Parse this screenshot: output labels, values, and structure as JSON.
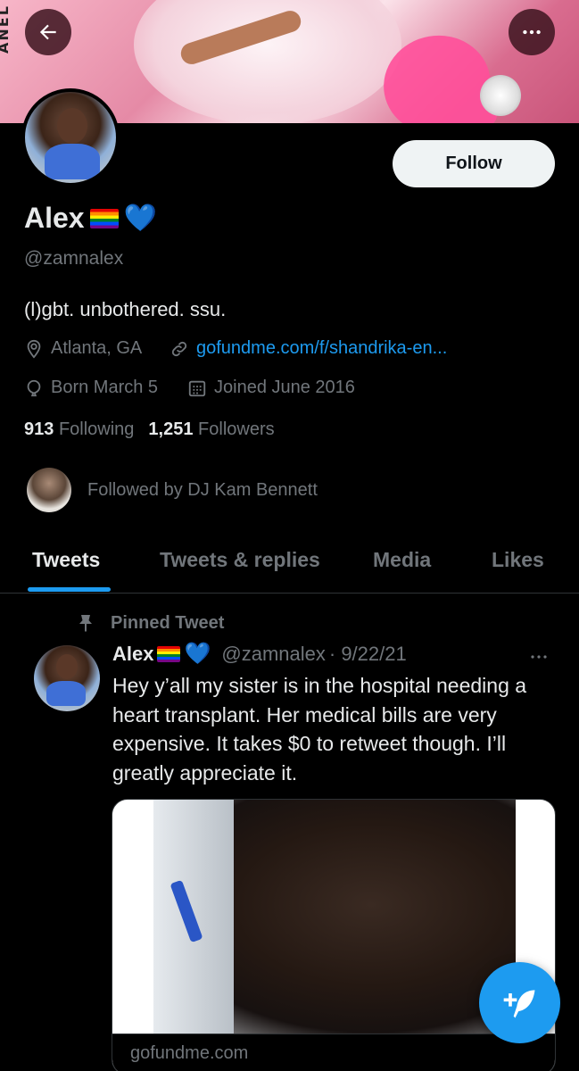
{
  "header": {
    "banner_brand_text": "ANEL",
    "back_icon": "arrow-left-icon",
    "more_icon": "more-horizontal-icon"
  },
  "profile": {
    "name": "Alex",
    "name_emojis": [
      "rainbow-flag",
      "blue-heart"
    ],
    "handle": "@zamnalex",
    "bio": "(l)gbt. unbothered. ssu.",
    "location": "Atlanta, GA",
    "link": "gofundme.com/f/shandrika-en...",
    "birthday": "Born March 5",
    "joined": "Joined June 2016",
    "following_count": "913",
    "following_label": "Following",
    "followers_count": "1,251",
    "followers_label": "Followers",
    "followed_by": "Followed by DJ Kam Bennett",
    "follow_button": "Follow"
  },
  "tabs": [
    {
      "label": "Tweets",
      "active": true
    },
    {
      "label": "Tweets & replies",
      "active": false
    },
    {
      "label": "Media",
      "active": false
    },
    {
      "label": "Likes",
      "active": false
    }
  ],
  "pinned_tweet": {
    "pinned_label": "Pinned Tweet",
    "author_name": "Alex",
    "author_handle": "@zamnalex",
    "date": "· 9/22/21",
    "text": "Hey y’all my sister is in the hospital needing a heart transplant. Her medical bills are very expensive. It takes $0 to retweet though. I’ll greatly appreciate it.",
    "card_domain": "gofundme.com"
  },
  "colors": {
    "background": "#000000",
    "text_primary": "#e7e9ea",
    "text_secondary": "#71767b",
    "accent": "#1d9bf0",
    "follow_button_bg": "#eff3f4"
  }
}
